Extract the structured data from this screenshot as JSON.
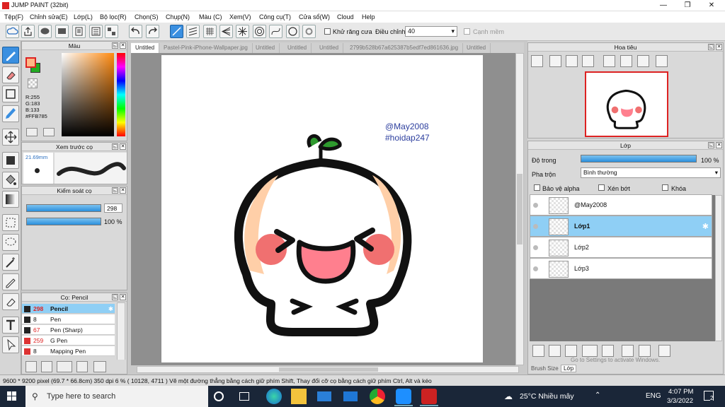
{
  "window": {
    "title": "JUMP PAINT (32bit)",
    "min": "—",
    "max": "❐",
    "close": "✕"
  },
  "menu": [
    "Tệp(F)",
    "Chỉnh sửa(E)",
    "Lớp(L)",
    "Bộ lọc(R)",
    "Chọn(S)",
    "Chụp(N)",
    "Màu (C)",
    "Xem(V)",
    "Công cụ(T)",
    "Cửa sổ(W)",
    "Cloud",
    "Help"
  ],
  "toolbar": {
    "antialias_label": "Khử răng cưa",
    "adjust_label": "Điều chỉnh",
    "adjust_value": "40",
    "snap_label": "Cạnh mềm"
  },
  "color_panel": {
    "title": "Màu",
    "r": "R:255",
    "g": "G:183",
    "b": "B:133",
    "hex": "#FFB785",
    "fg_color": "#FFB785",
    "bg_color": "#22aa22"
  },
  "brush_preview": {
    "title": "Xem trước cọ",
    "size": "21.69mm"
  },
  "brush_control": {
    "title": "Kiểm soát cọ",
    "size_value": "298",
    "opacity_value": "100 %"
  },
  "brush_list": {
    "title": "Cọ: Pencil",
    "items": [
      {
        "size": "298",
        "name": "Pencil",
        "color": "#222222",
        "selected": true
      },
      {
        "size": "8",
        "name": "Pen",
        "color": "#222222",
        "selected": false
      },
      {
        "size": "67",
        "name": "Pen (Sharp)",
        "color": "#222222",
        "selected": false
      },
      {
        "size": "259",
        "name": "G Pen",
        "color": "#dd3333",
        "selected": false
      },
      {
        "size": "8",
        "name": "Mapping Pen",
        "color": "#dd3333",
        "selected": false
      }
    ]
  },
  "tabs": [
    "Untitled",
    "Pastel-Pink-iPhone-Wallpaper.jpg",
    "Untitled",
    "Untitled",
    "Untitled",
    "2799b528b67a625387b5edf7ed861636.jpg",
    "Untitled"
  ],
  "canvas_text": {
    "line1": "@May2008",
    "line2": "#hoidap247"
  },
  "navigator": {
    "title": "Hoa tiêu"
  },
  "layer_panel": {
    "title": "Lớp",
    "opacity_label": "Độ trong",
    "opacity_value": "100 %",
    "blend_label": "Pha trộn",
    "blend_value": "Bình thường",
    "protect_alpha": "Bảo vệ alpha",
    "clip": "Xén bớt",
    "lock": "Khóa",
    "layers": [
      {
        "name": "@May2008",
        "selected": false
      },
      {
        "name": "Lớp1",
        "selected": true
      },
      {
        "name": "Lớp2",
        "selected": false
      },
      {
        "name": "Lớp3",
        "selected": false
      }
    ],
    "brush_size_tab": "Brush Size",
    "layer_tab": "Lớp",
    "activate": "Go to Settings to activate Windows."
  },
  "status": {
    "text": "9600 * 9200 pixel   (69.7 * 66.8cm)   350 dpi   6 %   ( 10128, 4711 )   Vẽ một đường thẳng bằng cách giữ phím Shift, Thay đổi cỡ cọ bằng cách giữ phím Ctrl, Alt và kéo"
  },
  "taskbar": {
    "search_placeholder": "Type here to search",
    "weather": "25°C  Nhiều mây",
    "lang": "ENG",
    "time": "4:07 PM",
    "date": "3/3/2022",
    "notif": "2"
  }
}
